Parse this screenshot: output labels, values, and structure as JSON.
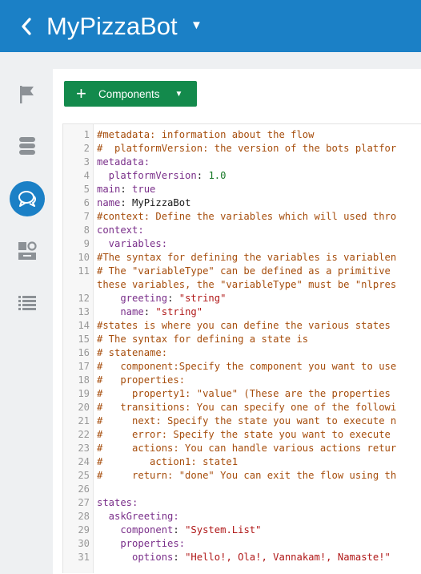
{
  "header": {
    "title": "MyPizzaBot",
    "back_icon": "chevron-left-icon",
    "dropdown_icon": "caret-down-icon"
  },
  "sidebar": {
    "items": [
      {
        "icon": "flag-icon",
        "active": false
      },
      {
        "icon": "database-icon",
        "active": false
      },
      {
        "icon": "chat-icon",
        "active": true
      },
      {
        "icon": "settings-tools-icon",
        "active": false
      },
      {
        "icon": "list-icon",
        "active": false
      }
    ]
  },
  "toolbar": {
    "components_label": "Components"
  },
  "colors": {
    "header": "#1b80c6",
    "button": "#138a4c",
    "comment": "#a64d0c",
    "key": "#7a2f8a",
    "string": "#b01818",
    "number": "#1a7a2a"
  },
  "editor": {
    "lines": [
      {
        "n": "1",
        "segs": [
          {
            "t": "#metadata: information about the flow",
            "c": "cmt"
          }
        ]
      },
      {
        "n": "2",
        "segs": [
          {
            "t": "#  platformVersion: the version of the bots platfor",
            "c": "cmt"
          }
        ]
      },
      {
        "n": "3",
        "segs": [
          {
            "t": "metadata:",
            "c": "key"
          }
        ]
      },
      {
        "n": "4",
        "segs": [
          {
            "t": "  platformVersion",
            "c": "key"
          },
          {
            "t": ": ",
            "c": "val"
          },
          {
            "t": "1.0",
            "c": "num"
          }
        ]
      },
      {
        "n": "5",
        "segs": [
          {
            "t": "main",
            "c": "key"
          },
          {
            "t": ": ",
            "c": "val"
          },
          {
            "t": "true",
            "c": "key"
          }
        ]
      },
      {
        "n": "6",
        "segs": [
          {
            "t": "name",
            "c": "key"
          },
          {
            "t": ": MyPizzaBot",
            "c": "val"
          }
        ]
      },
      {
        "n": "7",
        "segs": [
          {
            "t": "#context: Define the variables which will used thro",
            "c": "cmt"
          }
        ]
      },
      {
        "n": "8",
        "segs": [
          {
            "t": "context:",
            "c": "key"
          }
        ]
      },
      {
        "n": "9",
        "segs": [
          {
            "t": "  variables:",
            "c": "key"
          }
        ]
      },
      {
        "n": "10",
        "segs": [
          {
            "t": "#The syntax for defining the variables is variablen",
            "c": "cmt"
          }
        ]
      },
      {
        "n": "11",
        "tall": true,
        "segs": [
          {
            "t": "# The \"variableType\" can be defined as a primitive\nthese variables, the \"variableType\" must be \"nlpres",
            "c": "cmt"
          }
        ]
      },
      {
        "n": "12",
        "segs": [
          {
            "t": "    greeting",
            "c": "key"
          },
          {
            "t": ": ",
            "c": "val"
          },
          {
            "t": "\"string\"",
            "c": "str"
          }
        ]
      },
      {
        "n": "13",
        "segs": [
          {
            "t": "    name",
            "c": "key"
          },
          {
            "t": ": ",
            "c": "val"
          },
          {
            "t": "\"string\"",
            "c": "str"
          }
        ]
      },
      {
        "n": "14",
        "segs": [
          {
            "t": "#states is where you can define the various states",
            "c": "cmt"
          }
        ]
      },
      {
        "n": "15",
        "segs": [
          {
            "t": "# The syntax for defining a state is",
            "c": "cmt"
          }
        ]
      },
      {
        "n": "16",
        "segs": [
          {
            "t": "# statename:",
            "c": "cmt"
          }
        ]
      },
      {
        "n": "17",
        "segs": [
          {
            "t": "#   component:Specify the component you want to use",
            "c": "cmt"
          }
        ]
      },
      {
        "n": "18",
        "segs": [
          {
            "t": "#   properties:",
            "c": "cmt"
          }
        ]
      },
      {
        "n": "19",
        "segs": [
          {
            "t": "#     property1: \"value\" (These are the properties",
            "c": "cmt"
          }
        ]
      },
      {
        "n": "20",
        "segs": [
          {
            "t": "#   transitions: You can specify one of the followi",
            "c": "cmt"
          }
        ]
      },
      {
        "n": "21",
        "segs": [
          {
            "t": "#     next: Specify the state you want to execute n",
            "c": "cmt"
          }
        ]
      },
      {
        "n": "22",
        "segs": [
          {
            "t": "#     error: Specify the state you want to execute",
            "c": "cmt"
          }
        ]
      },
      {
        "n": "23",
        "segs": [
          {
            "t": "#     actions: You can handle various actions retur",
            "c": "cmt"
          }
        ]
      },
      {
        "n": "24",
        "segs": [
          {
            "t": "#        action1: state1",
            "c": "cmt"
          }
        ]
      },
      {
        "n": "25",
        "segs": [
          {
            "t": "#     return: \"done\" You can exit the flow using th",
            "c": "cmt"
          }
        ]
      },
      {
        "n": "26",
        "segs": [
          {
            "t": "",
            "c": "val"
          }
        ]
      },
      {
        "n": "27",
        "segs": [
          {
            "t": "states:",
            "c": "key"
          }
        ]
      },
      {
        "n": "28",
        "segs": [
          {
            "t": "  askGreeting:",
            "c": "key"
          }
        ]
      },
      {
        "n": "29",
        "segs": [
          {
            "t": "    component",
            "c": "key"
          },
          {
            "t": ": ",
            "c": "val"
          },
          {
            "t": "\"System.List\"",
            "c": "str"
          }
        ]
      },
      {
        "n": "30",
        "segs": [
          {
            "t": "    properties:",
            "c": "key"
          }
        ]
      },
      {
        "n": "31",
        "segs": [
          {
            "t": "      options",
            "c": "key"
          },
          {
            "t": ": ",
            "c": "val"
          },
          {
            "t": "\"Hello!, Ola!, Vannakam!, Namaste!\"",
            "c": "str"
          }
        ]
      }
    ]
  }
}
